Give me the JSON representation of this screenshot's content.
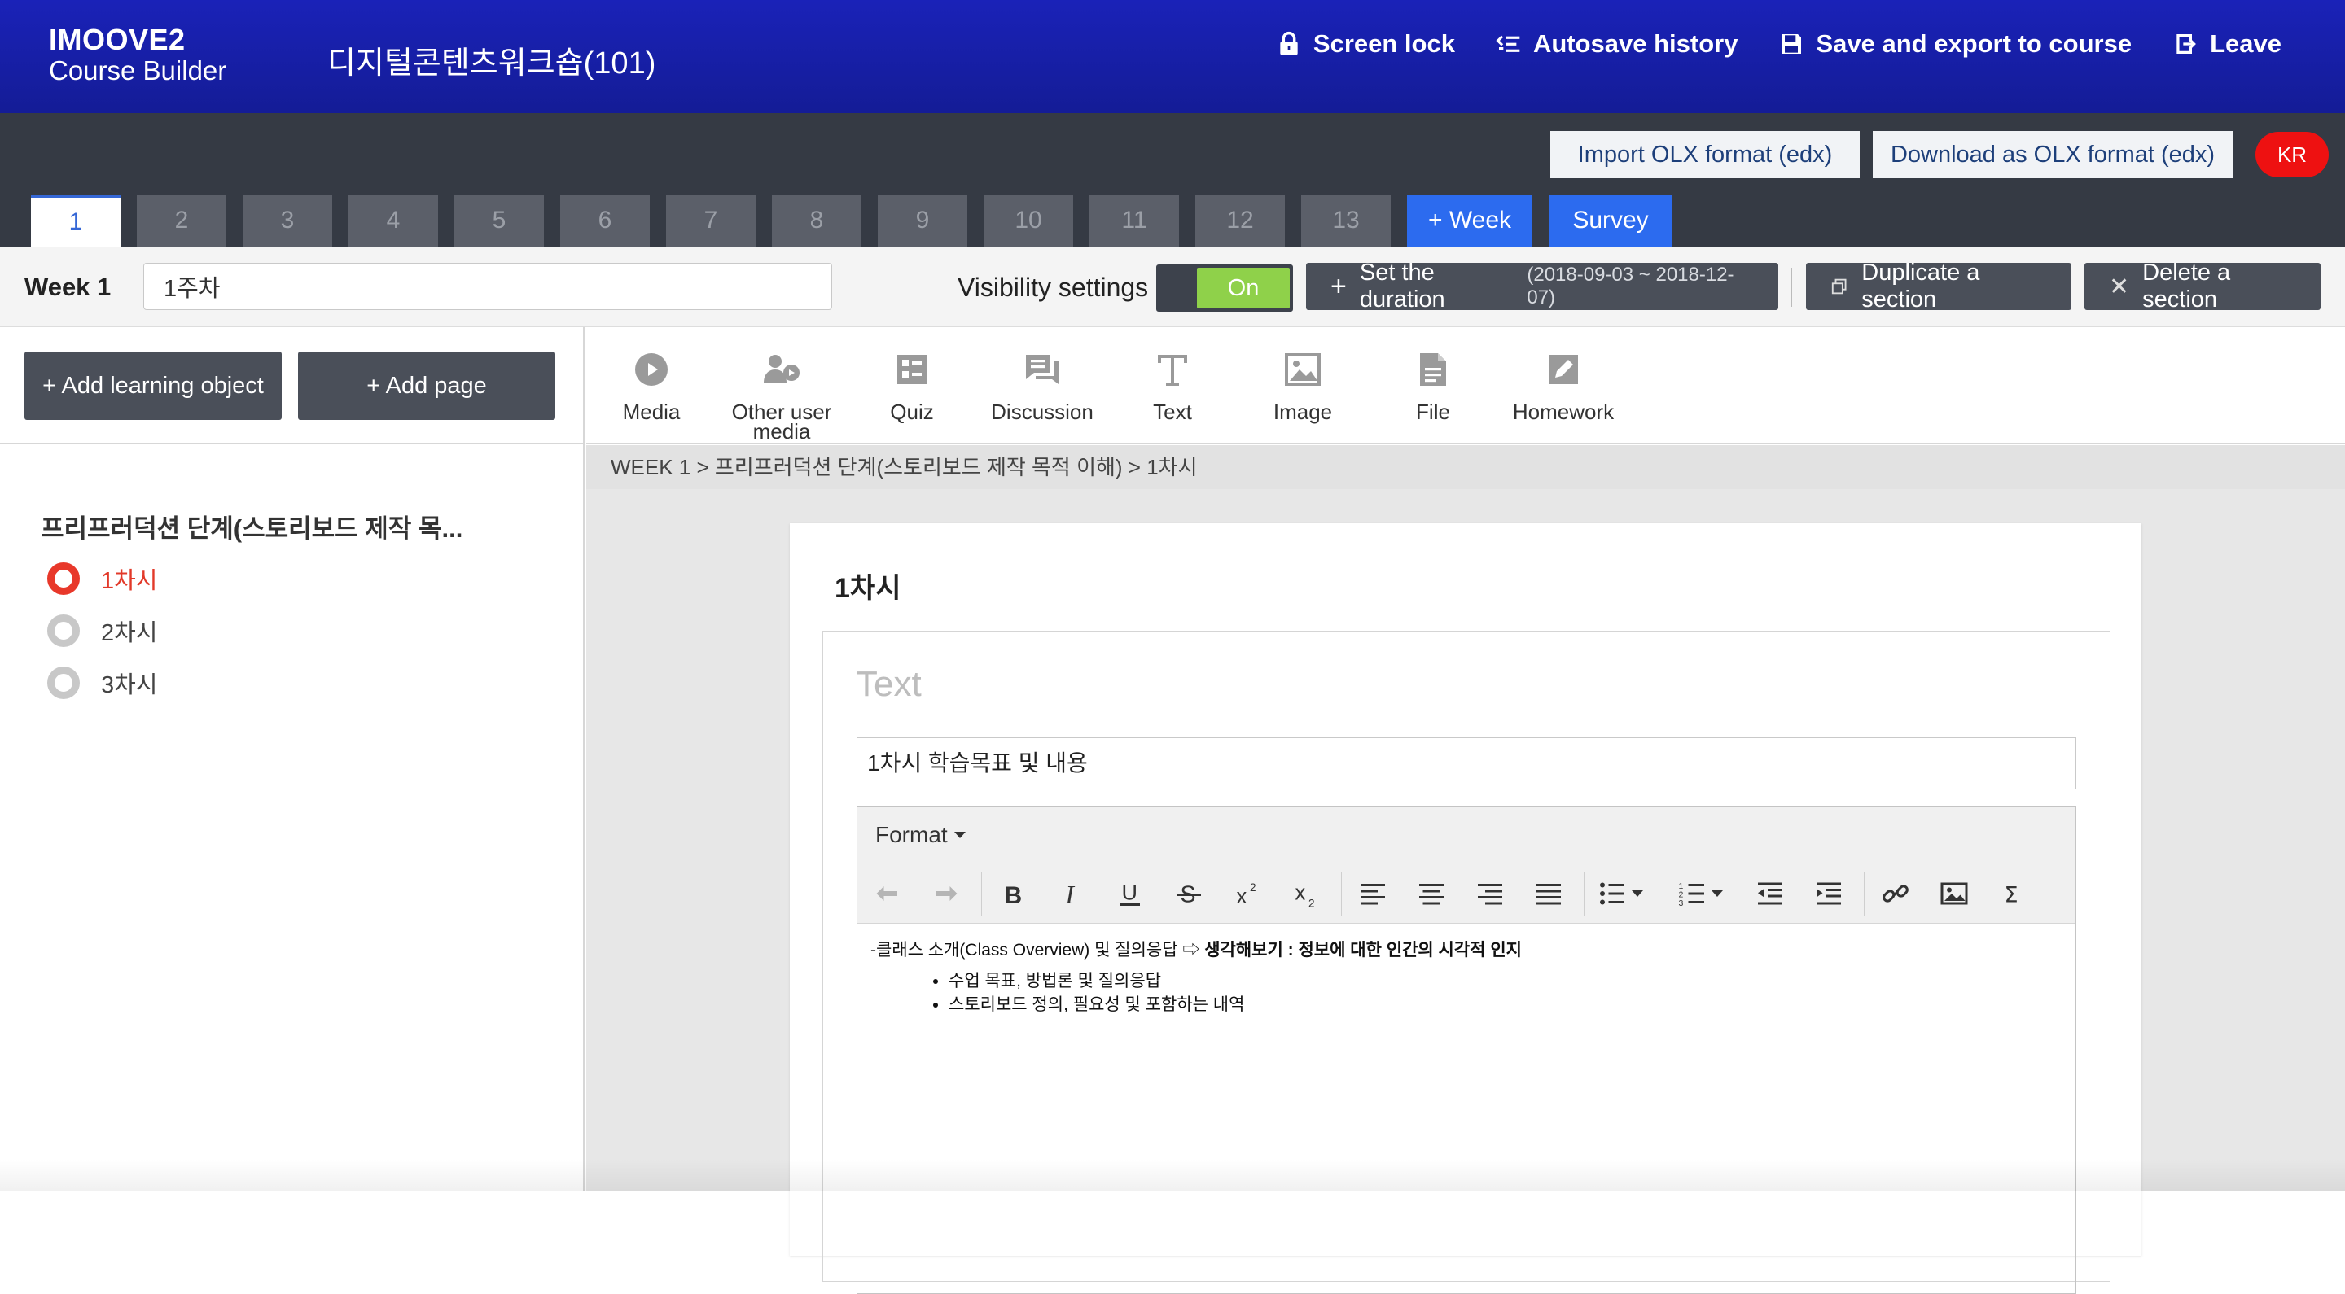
{
  "header": {
    "brand_line1": "IMOOVE2",
    "brand_line2": "Course Builder",
    "course_title": "디지털콘텐츠워크숍(101)",
    "actions": {
      "screen_lock": "Screen lock",
      "autosave_history": "Autosave history",
      "save_export": "Save and export to course",
      "leave": "Leave"
    }
  },
  "subheader": {
    "import_olx": "Import OLX format (edx)",
    "download_olx": "Download as OLX format (edx)",
    "lang": "KR",
    "week_tabs": [
      "1",
      "2",
      "3",
      "4",
      "5",
      "6",
      "7",
      "8",
      "9",
      "10",
      "11",
      "12",
      "13"
    ],
    "add_week": "+ Week",
    "survey": "Survey"
  },
  "week_row": {
    "label": "Week 1",
    "title_value": "1주차",
    "visibility_label": "Visibility settings :",
    "visibility_state": "On",
    "duration_label": "Set the duration",
    "duration_range": "(2018-09-03 ~ 2018-12-07)",
    "duplicate_section": "Duplicate a section",
    "delete_section": "Delete a section"
  },
  "left_panel": {
    "add_learning_object": "+ Add learning object",
    "add_page": "+ Add page",
    "section_title": "프리프러덕션 단계(스토리보드 제작 목...",
    "lessons": [
      "1차시",
      "2차시",
      "3차시"
    ]
  },
  "object_toolbar": {
    "media": "Media",
    "other_user_media_1": "Other user",
    "other_user_media_2": "media",
    "quiz": "Quiz",
    "discussion": "Discussion",
    "text": "Text",
    "image": "Image",
    "file": "File",
    "homework": "Homework"
  },
  "breadcrumb": "WEEK 1 > 프리프러덕션 단계(스토리보드 제작 목적 이해) > 1차시",
  "page": {
    "title": "1차시",
    "block_type": "Text",
    "block_title": "1차시 학습목표 및 내용",
    "format_label": "Format",
    "content_line_prefix": "-클래스 소개(Class Overview) 및 질의응답 ⇨ ",
    "content_line_bold": "생각해보기 : 정보에 대한 인간의 시각적 인지",
    "content_items": [
      "수업 목표, 방법론 및 질의응답",
      "스토리보드 정의, 필요성 및 포함하는 내역"
    ]
  },
  "colors": {
    "header_bg": "#1a22b8",
    "tabbar_bg": "#353a44",
    "active_tab_accent": "#3567d6",
    "blue_tab": "#2c6bef",
    "toggle_on": "#8fd14a",
    "lang_badge": "#ee1111",
    "active_lesson": "#e8382a"
  }
}
